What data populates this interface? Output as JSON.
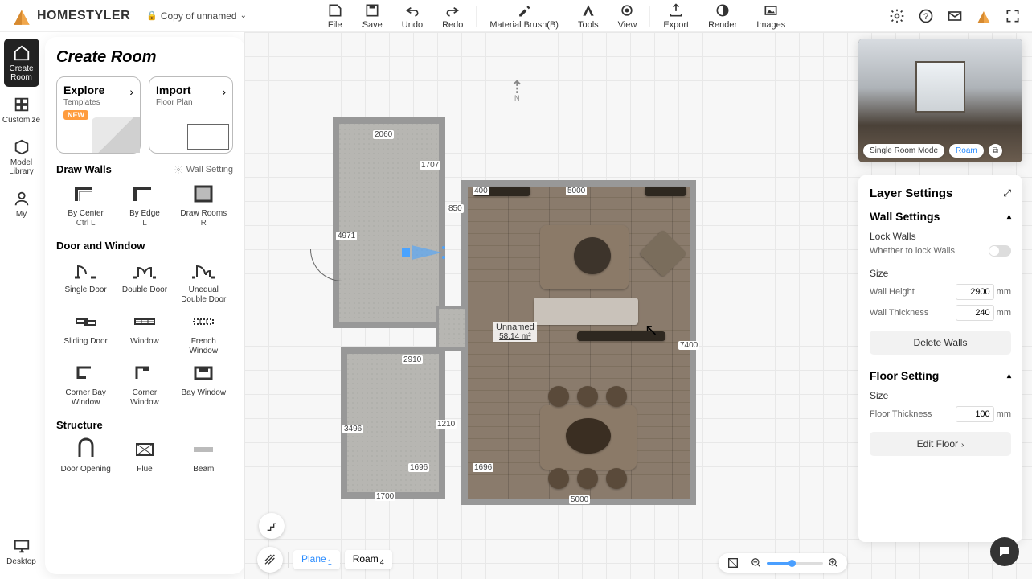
{
  "header": {
    "brand": "HOMESTYLER",
    "file_name": "Copy of unnamed",
    "tools": {
      "file": "File",
      "save": "Save",
      "undo": "Undo",
      "redo": "Redo",
      "material": "Material Brush(B)",
      "tools": "Tools",
      "view": "View",
      "export": "Export",
      "render": "Render",
      "images": "Images"
    }
  },
  "rail": {
    "create_room": "Create\nRoom",
    "customize": "Customize",
    "model_library": "Model\nLibrary",
    "my": "My",
    "desktop": "Desktop"
  },
  "panel": {
    "title": "Create Room",
    "cards": {
      "explore": {
        "title": "Explore",
        "sub": "Templates",
        "badge": "NEW"
      },
      "import": {
        "title": "Import",
        "sub": "Floor Plan"
      }
    },
    "draw_walls": {
      "title": "Draw Walls",
      "setting": "Wall Setting",
      "items": [
        {
          "l": "By Center",
          "s": "Ctrl L"
        },
        {
          "l": "By Edge",
          "s": "L"
        },
        {
          "l": "Draw Rooms",
          "s": "R"
        }
      ]
    },
    "door_window": {
      "title": "Door and Window",
      "items": [
        {
          "l": "Single Door"
        },
        {
          "l": "Double Door"
        },
        {
          "l": "Unequal\nDouble Door"
        },
        {
          "l": "Sliding Door"
        },
        {
          "l": "Window"
        },
        {
          "l": "French\nWindow"
        },
        {
          "l": "Corner Bay\nWindow"
        },
        {
          "l": "Corner\nWindow"
        },
        {
          "l": "Bay Window"
        }
      ]
    },
    "structure": {
      "title": "Structure",
      "items": [
        {
          "l": "Door Opening"
        },
        {
          "l": "Flue"
        },
        {
          "l": "Beam"
        }
      ]
    }
  },
  "canvas": {
    "dims": {
      "d1": "2060",
      "d2": "1707",
      "d3": "4971",
      "d4": "850",
      "d5": "400",
      "d6": "5000",
      "d7": "2910",
      "d8": "3496",
      "d9": "1210",
      "d10": "1696",
      "d11": "1696",
      "d12": "1700",
      "d13": "5000",
      "d14": "7400"
    },
    "room_label": "Unnamed",
    "room_area": "58.14 m²",
    "compass": "N"
  },
  "preview": {
    "mode_single": "Single Room Mode",
    "mode_roam": "Roam"
  },
  "layer": {
    "title": "Layer Settings",
    "wall_section": "Wall Settings",
    "lock_walls": "Lock Walls",
    "lock_desc": "Whether to lock Walls",
    "size": "Size",
    "wall_height": "Wall Height",
    "wall_height_v": "2900",
    "wall_thick": "Wall Thickness",
    "wall_thick_v": "240",
    "unit": "mm",
    "delete_walls": "Delete Walls",
    "floor_section": "Floor Setting",
    "floor_thick": "Floor Thickness",
    "floor_thick_v": "100",
    "edit_floor": "Edit Floor"
  },
  "footer": {
    "plane": "Plane",
    "plane_idx": "1",
    "roam": "Roam",
    "roam_idx": "4"
  }
}
